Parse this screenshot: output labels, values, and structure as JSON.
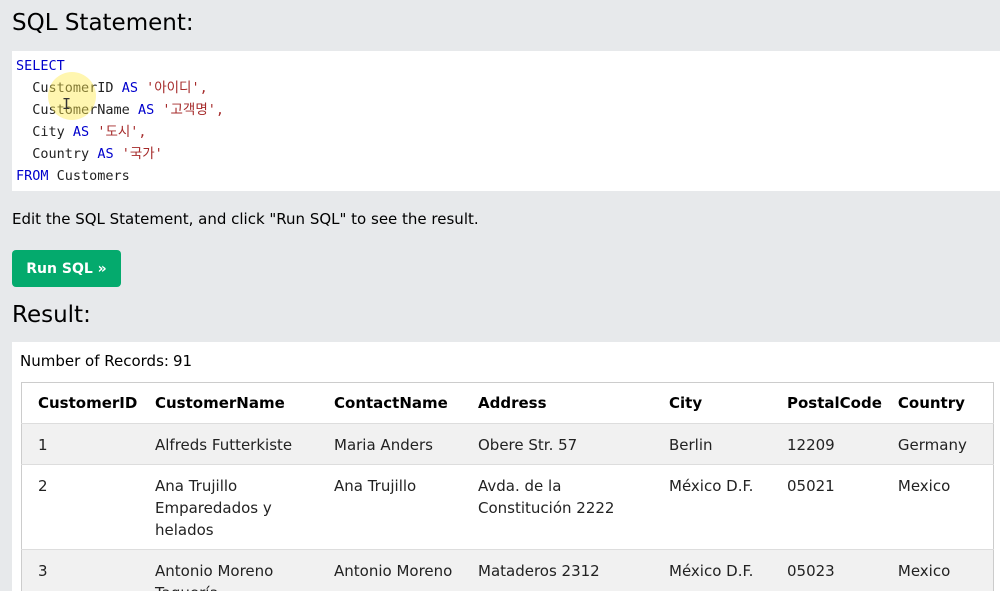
{
  "sql_heading": "SQL Statement:",
  "sql": {
    "line1_kw": "SELECT",
    "line2_field": "CustomerID",
    "line2_as": "AS",
    "line2_alias": "'아이디',",
    "line3_field": "CustomerName",
    "line3_as": "AS",
    "line3_alias": "'고객명',",
    "line4_field": "City",
    "line4_as": "AS",
    "line4_alias": "'도시',",
    "line5_field": "Country",
    "line5_as": "AS",
    "line5_alias": "'국가'",
    "line6_kw": "FROM",
    "line6_table": "Customers"
  },
  "instructions": "Edit the SQL Statement, and click \"Run SQL\" to see the result.",
  "run_button_label": "Run SQL »",
  "result_heading": "Result:",
  "records_label": "Number of Records:",
  "records_value": "91",
  "columns": [
    "CustomerID",
    "CustomerName",
    "ContactName",
    "Address",
    "City",
    "PostalCode",
    "Country"
  ],
  "rows": [
    [
      "1",
      "Alfreds Futterkiste",
      "Maria Anders",
      "Obere Str. 57",
      "Berlin",
      "12209",
      "Germany"
    ],
    [
      "2",
      "Ana Trujillo Emparedados y helados",
      "Ana Trujillo",
      "Avda. de la Constitución 2222",
      "México D.F.",
      "05021",
      "Mexico"
    ],
    [
      "3",
      "Antonio Moreno Taquería",
      "Antonio Moreno",
      "Mataderos 2312",
      "México D.F.",
      "05023",
      "Mexico"
    ]
  ],
  "colors": {
    "page_bg": "#e7e9eb",
    "keyword": "#0000cd",
    "string": "#a52a2a",
    "run_button": "#04aa6d",
    "row_stripe": "#f1f1f1"
  }
}
